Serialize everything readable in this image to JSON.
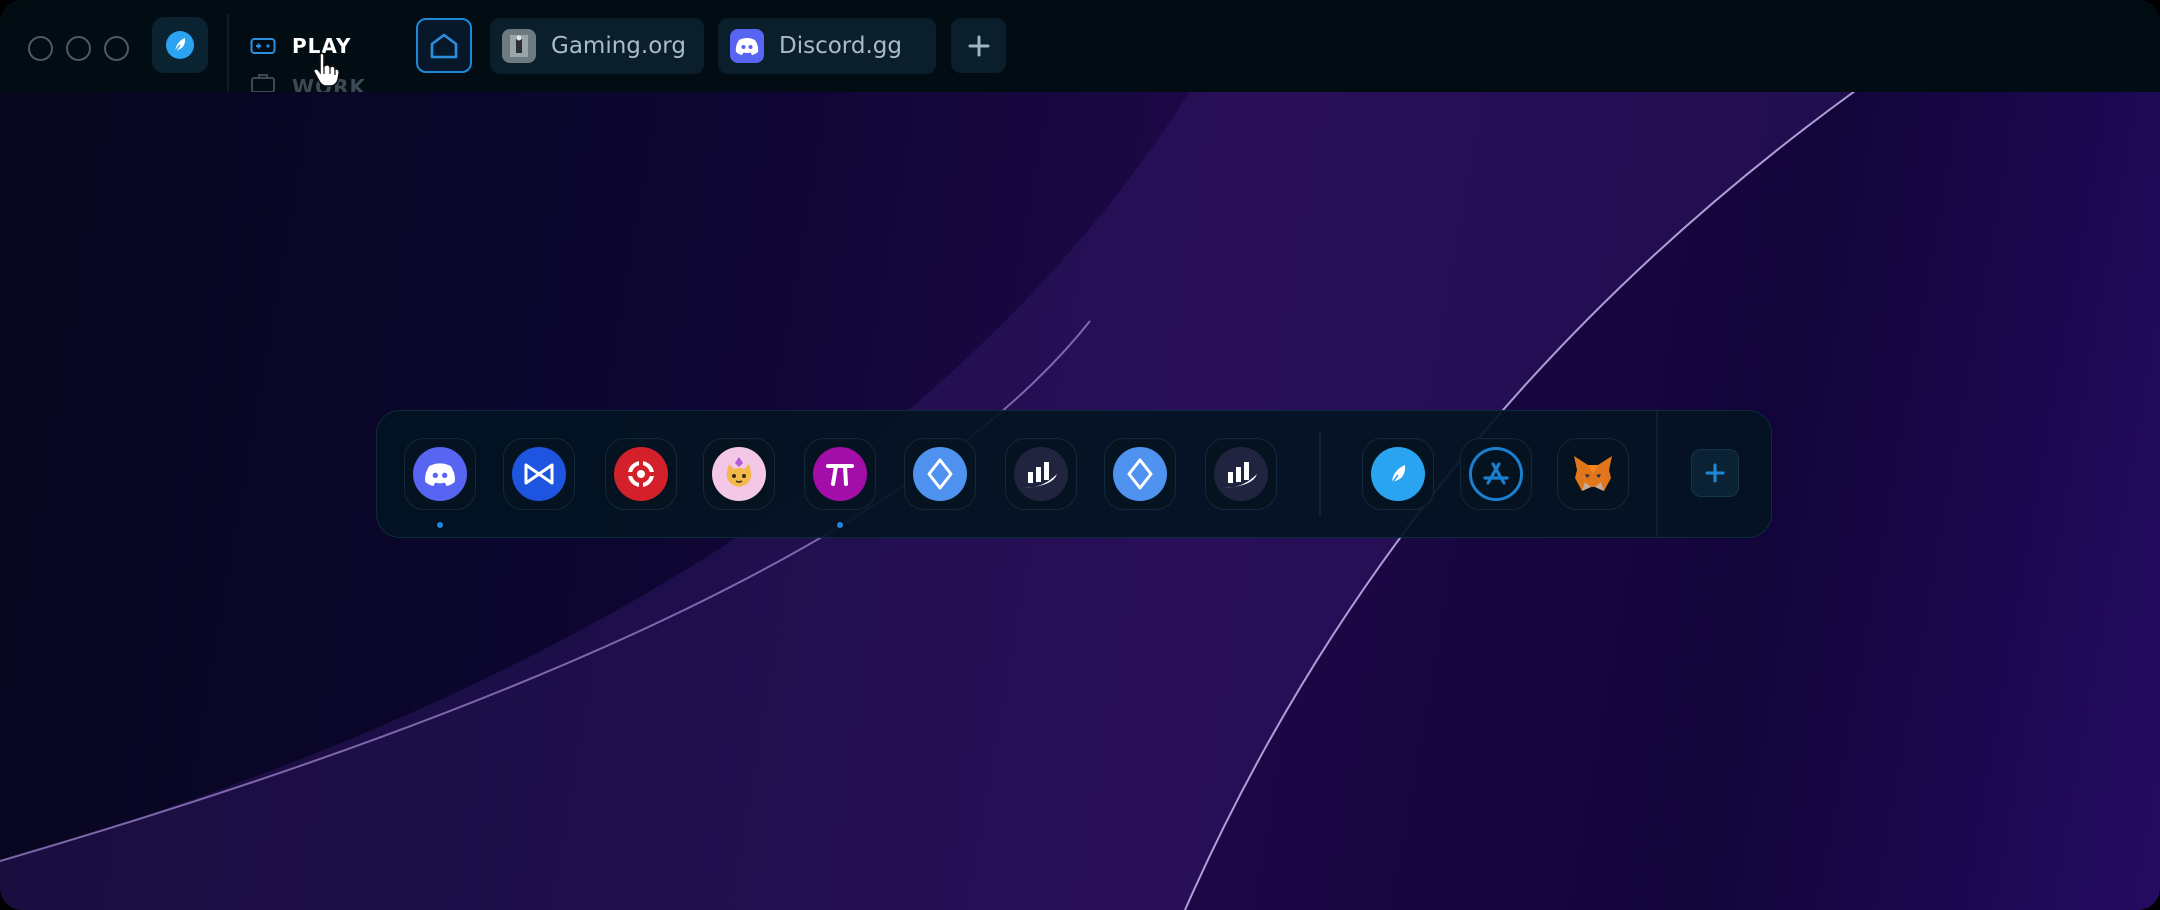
{
  "titlebar": {
    "window_controls": [
      "window-control",
      "window-control",
      "window-control"
    ],
    "app_icon": "feather-leaf-icon",
    "modes": [
      {
        "label": "PLAY",
        "icon": "gamepad-icon",
        "active": true
      },
      {
        "label": "WORK",
        "icon": "briefcase-icon",
        "active": false
      }
    ],
    "home_icon": "home-icon",
    "tabs": [
      {
        "label": "Gaming.org",
        "icon": "gaming-org-icon"
      },
      {
        "label": "Discord.gg",
        "icon": "discord-icon"
      }
    ],
    "new_tab_icon": "plus-icon"
  },
  "dock": {
    "apps": [
      {
        "name": "discord",
        "icon": "discord-icon",
        "color": "#5865f2",
        "running": true
      },
      {
        "name": "axie",
        "icon": "axie-bowtie-icon",
        "color": "#1d55e0",
        "running": false
      },
      {
        "name": "lifebuoy",
        "icon": "red-ring-icon",
        "color": "#d4202b",
        "running": false
      },
      {
        "name": "cat",
        "icon": "cat-nft-icon",
        "color": "#f3c7e6",
        "running": false
      },
      {
        "name": "pi-app",
        "icon": "pi-symbol-icon",
        "color": "#a30ea8",
        "running": true
      },
      {
        "name": "ens-1",
        "icon": "ens-diamond-icon",
        "color": "#4f92f0",
        "running": false
      },
      {
        "name": "chart-1",
        "icon": "bar-chart-swoosh-icon",
        "color": "#20243f",
        "running": false
      },
      {
        "name": "ens-2",
        "icon": "ens-diamond-icon",
        "color": "#4f92f0",
        "running": false
      },
      {
        "name": "chart-2",
        "icon": "bar-chart-swoosh-icon",
        "color": "#20243f",
        "running": false
      },
      {
        "name": "leaf-app",
        "icon": "feather-leaf-icon",
        "color": "#2aa3f0",
        "running": false
      },
      {
        "name": "app-store",
        "icon": "app-store-icon",
        "color": "#1a7fd0",
        "running": false
      },
      {
        "name": "metamask",
        "icon": "metamask-fox-icon",
        "color": "#e2761b",
        "running": false
      }
    ],
    "add_icon": "plus-icon"
  },
  "colors": {
    "accent": "#1e8ad6",
    "titlebar_bg": "#010c13",
    "dock_bg": "#031422"
  }
}
